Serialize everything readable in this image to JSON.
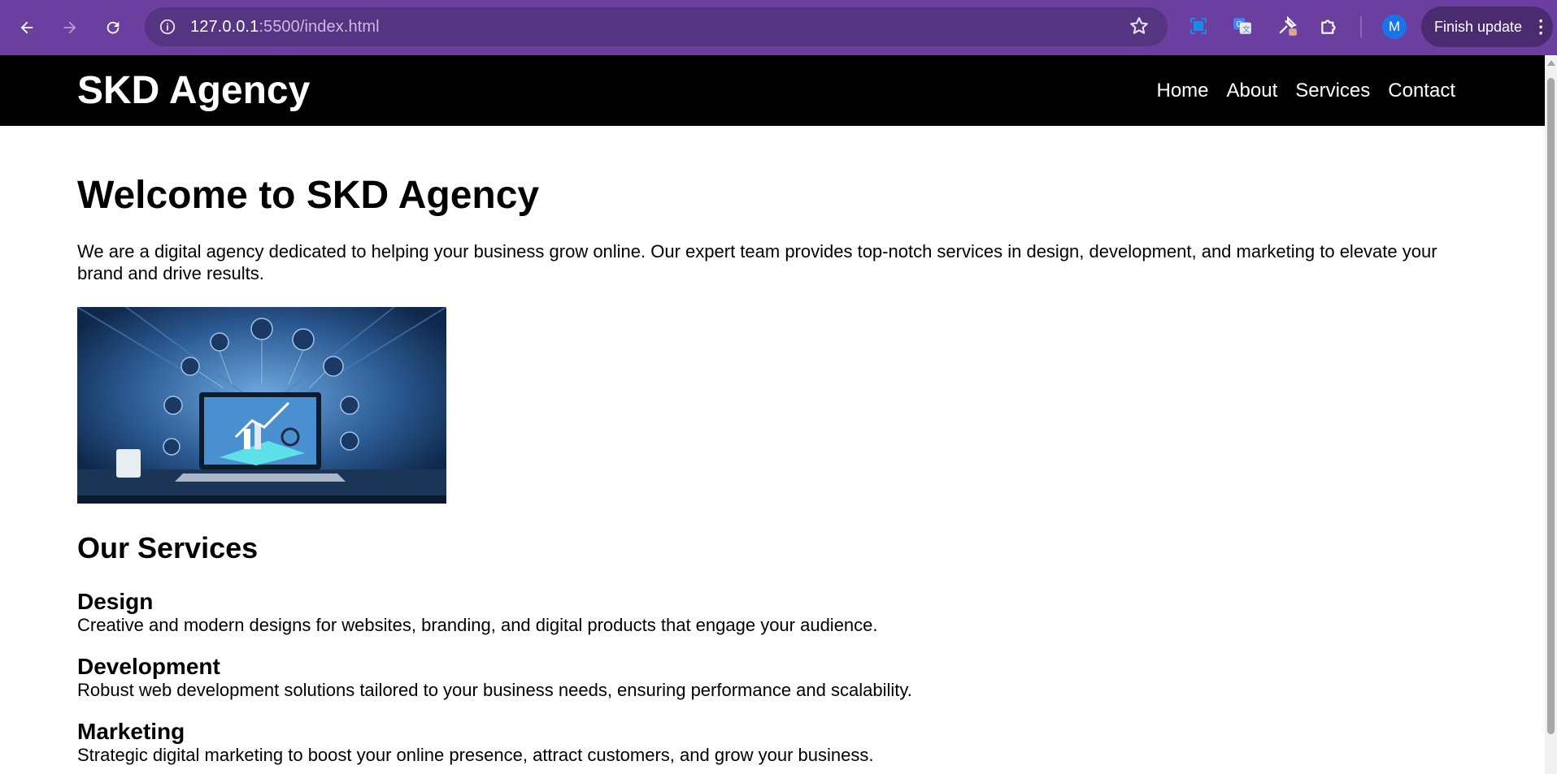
{
  "browser": {
    "url_host": "127.0.0.1",
    "url_path": ":5500/index.html",
    "profile_initial": "M",
    "finish_update_label": "Finish update",
    "icons": [
      "back-icon",
      "forward-icon",
      "reload-icon",
      "site-info-icon",
      "bookmark-star-icon",
      "screenshot-icon",
      "translate-icon",
      "extension-pin-icon",
      "extensions-puzzle-icon",
      "menu-dots-icon"
    ]
  },
  "site": {
    "logo": "SKD Agency",
    "nav": [
      "Home",
      "About",
      "Services",
      "Contact"
    ],
    "heading": "Welcome to SKD Agency",
    "intro": "We are a digital agency dedicated to helping your business grow online. Our expert team provides top-notch services in design, development, and marketing to elevate your brand and drive results.",
    "services_heading": "Our Services",
    "services": [
      {
        "title": "Design",
        "text": "Creative and modern designs for websites, branding, and digital products that engage your audience."
      },
      {
        "title": "Development",
        "text": "Robust web development solutions tailored to your business needs, ensuring performance and scalability."
      },
      {
        "title": "Marketing",
        "text": "Strategic digital marketing to boost your online presence, attract customers, and grow your business."
      }
    ]
  },
  "colors": {
    "chrome": "#6b3fa0",
    "omnibox": "#553481",
    "header_bg": "#000000",
    "text": "#000000"
  }
}
